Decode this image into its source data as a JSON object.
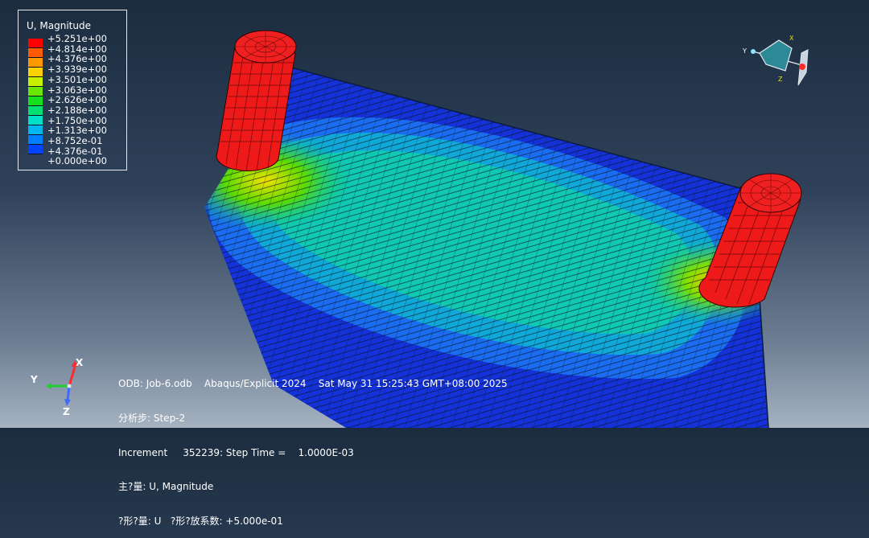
{
  "legend": {
    "title": "U, Magnitude",
    "levels": [
      "+5.251e+00",
      "+4.814e+00",
      "+4.376e+00",
      "+3.939e+00",
      "+3.501e+00",
      "+3.063e+00",
      "+2.626e+00",
      "+2.188e+00",
      "+1.750e+00",
      "+1.313e+00",
      "+8.752e-01",
      "+4.376e-01",
      "+0.000e+00"
    ],
    "colors": [
      "#ff0000",
      "#ff5a00",
      "#ff9900",
      "#ffd000",
      "#c8ee00",
      "#6ae600",
      "#14e01e",
      "#00e070",
      "#00dfc8",
      "#00b6ee",
      "#0080ff",
      "#0044ff",
      "#0000ff"
    ]
  },
  "info": {
    "line1": "ODB: Job-6.odb    Abaqus/Explicit 2024    Sat May 31 15:25:43 GMT+08:00 2025",
    "line2": "分析步: Step-2",
    "line3": "Increment     352239: Step Time =    1.0000E-03",
    "line4": "主?量: U, Magnitude",
    "line5": "?形?量: U   ?形?放系数: +5.000e-01"
  },
  "triad": {
    "x": "X",
    "y": "Y",
    "z": "Z"
  },
  "view_cube": {
    "x": "X",
    "y": "Y",
    "z": "Z"
  },
  "colors": {
    "x_axis": "#ff2a2a",
    "y_axis": "#22cc33",
    "z_axis": "#3a6cff",
    "cylinder": "#ee1a1a"
  }
}
